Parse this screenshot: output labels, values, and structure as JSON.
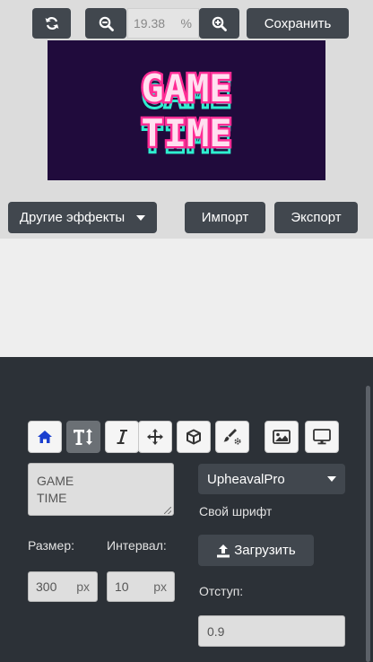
{
  "toolbar": {
    "refresh_icon": "refresh-icon",
    "zoom_out_icon": "zoom-out-icon",
    "zoom_in_icon": "zoom-in-icon",
    "zoom_value": "19.38",
    "zoom_unit": "%",
    "save_label": "Сохранить"
  },
  "preview": {
    "line1": "GAME",
    "line2": "TIME",
    "colors": {
      "background": "#200b3c",
      "fill": "#ffe0f0",
      "glow": "#ff2d95",
      "shadow": "#2ef0d0"
    }
  },
  "actions": {
    "effects_label": "Другие эффекты",
    "import_label": "Импорт",
    "export_label": "Экспорт"
  },
  "tools": [
    {
      "name": "home",
      "icon": "home-icon"
    },
    {
      "name": "text-size",
      "icon": "text-height-icon"
    },
    {
      "name": "italic",
      "icon": "italic-icon"
    },
    {
      "name": "move",
      "icon": "move-icon"
    },
    {
      "name": "3d",
      "icon": "cube-icon"
    },
    {
      "name": "style",
      "icon": "brush-gear-icon"
    },
    {
      "name": "image",
      "icon": "image-icon"
    },
    {
      "name": "display",
      "icon": "monitor-icon"
    }
  ],
  "text_editor": {
    "value": "GAME\nTIME"
  },
  "font": {
    "selected": "UpheavalPro",
    "custom_label": "Свой шрифт",
    "upload_label": "Загрузить"
  },
  "size": {
    "label": "Размер:",
    "value": "300",
    "unit": "px"
  },
  "spacing": {
    "label": "Интервал:",
    "value": "10",
    "unit": "px"
  },
  "indent": {
    "label": "Отступ:",
    "value": "0.9"
  }
}
